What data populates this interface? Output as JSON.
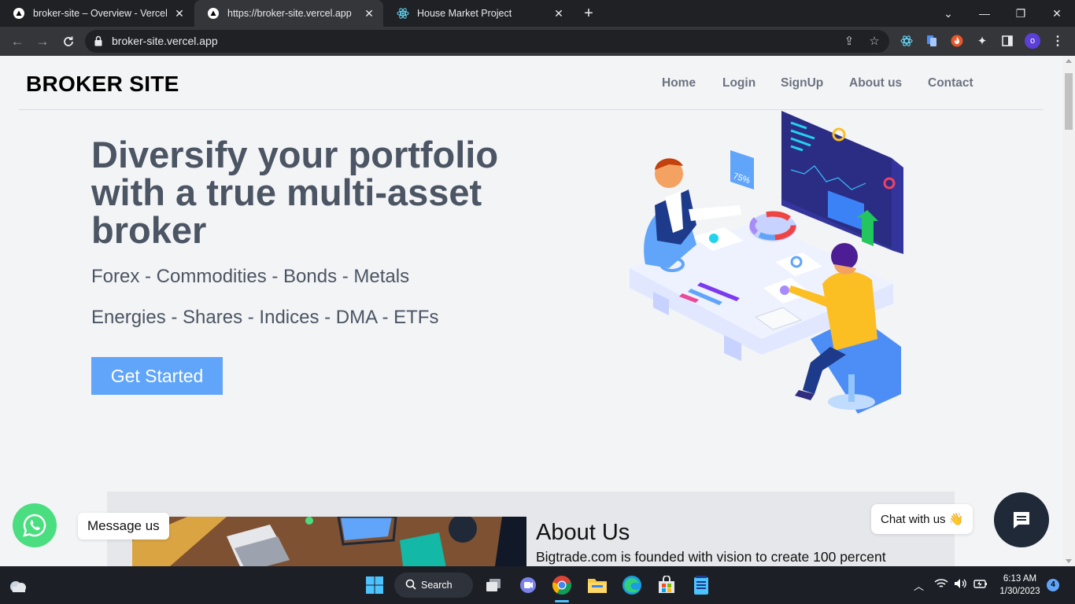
{
  "browser": {
    "tabs": [
      {
        "title": "broker-site – Overview - Vercel",
        "icon": "vercel-triangle-icon"
      },
      {
        "title": "https://broker-site.vercel.app",
        "icon": "vercel-triangle-icon"
      },
      {
        "title": "House Market Project",
        "icon": "react-icon"
      }
    ],
    "url": "broker-site.vercel.app",
    "profile_initial": "o"
  },
  "site": {
    "brand": "BROKER SITE",
    "nav": [
      "Home",
      "Login",
      "SignUp",
      "About us",
      "Contact"
    ],
    "hero": {
      "title": "Diversify your portfolio with a true multi-asset broker",
      "line1": "Forex - Commodities - Bonds - Metals",
      "line2": "Energies - Shares - Indices - DMA - ETFs",
      "cta": "Get Started",
      "badge": "75%"
    },
    "about": {
      "heading": "About Us",
      "text": "Bigtrade.com is founded with vision to create 100 percent"
    },
    "whatsapp_label": "Message us",
    "chat_label": "Chat with us 👋"
  },
  "taskbar": {
    "search_label": "Search",
    "time": "6:13 AM",
    "date": "1/30/2023",
    "notifications": "4"
  },
  "colors": {
    "accent": "#60a5fa",
    "hero_text": "#4b5563",
    "whatsapp": "#4ade80",
    "chat_button": "#1f2937"
  }
}
